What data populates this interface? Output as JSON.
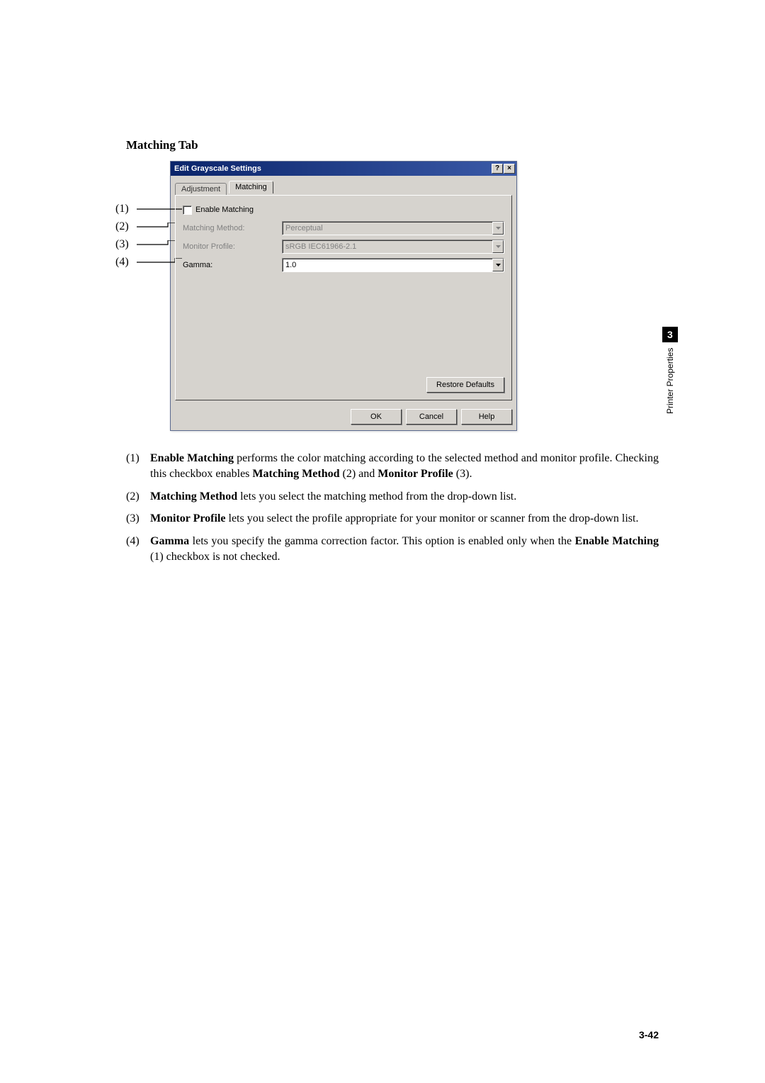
{
  "heading": "Matching Tab",
  "callouts": [
    "(1)",
    "(2)",
    "(3)",
    "(4)"
  ],
  "dialog": {
    "title": "Edit Grayscale Settings",
    "help_btn": "?",
    "close_btn": "×",
    "tabs": {
      "adjustment": "Adjustment",
      "matching": "Matching"
    },
    "fields": {
      "enable_matching": "Enable Matching",
      "matching_method_label": "Matching Method:",
      "matching_method_value": "Perceptual",
      "monitor_profile_label": "Monitor Profile:",
      "monitor_profile_value": "sRGB IEC61966-2.1",
      "gamma_label": "Gamma:",
      "gamma_value": "1.0"
    },
    "buttons": {
      "restore": "Restore Defaults",
      "ok": "OK",
      "cancel": "Cancel",
      "help": "Help"
    }
  },
  "list": {
    "i1_num": "(1)",
    "i1_a": "Enable Matching",
    "i1_b": " performs the color matching according to the selected method and monitor profile. Checking this checkbox enables ",
    "i1_c": "Matching Method",
    "i1_d": " (2) and ",
    "i1_e": "Monitor Profile",
    "i1_f": " (3).",
    "i2_num": "(2)",
    "i2_a": "Matching Method",
    "i2_b": " lets you select the matching method from the drop-down list.",
    "i3_num": "(3)",
    "i3_a": "Monitor Profile",
    "i3_b": " lets you select the profile appropriate for your monitor or scanner from the drop-down list.",
    "i4_num": "(4)",
    "i4_a": "Gamma",
    "i4_b": " lets you specify the gamma correction factor. This option is enabled only when the ",
    "i4_c": "Enable Matching",
    "i4_d": " (1) checkbox is not checked."
  },
  "side": {
    "label": "Printer Properties",
    "chapter": "3"
  },
  "page_number": "3-42"
}
